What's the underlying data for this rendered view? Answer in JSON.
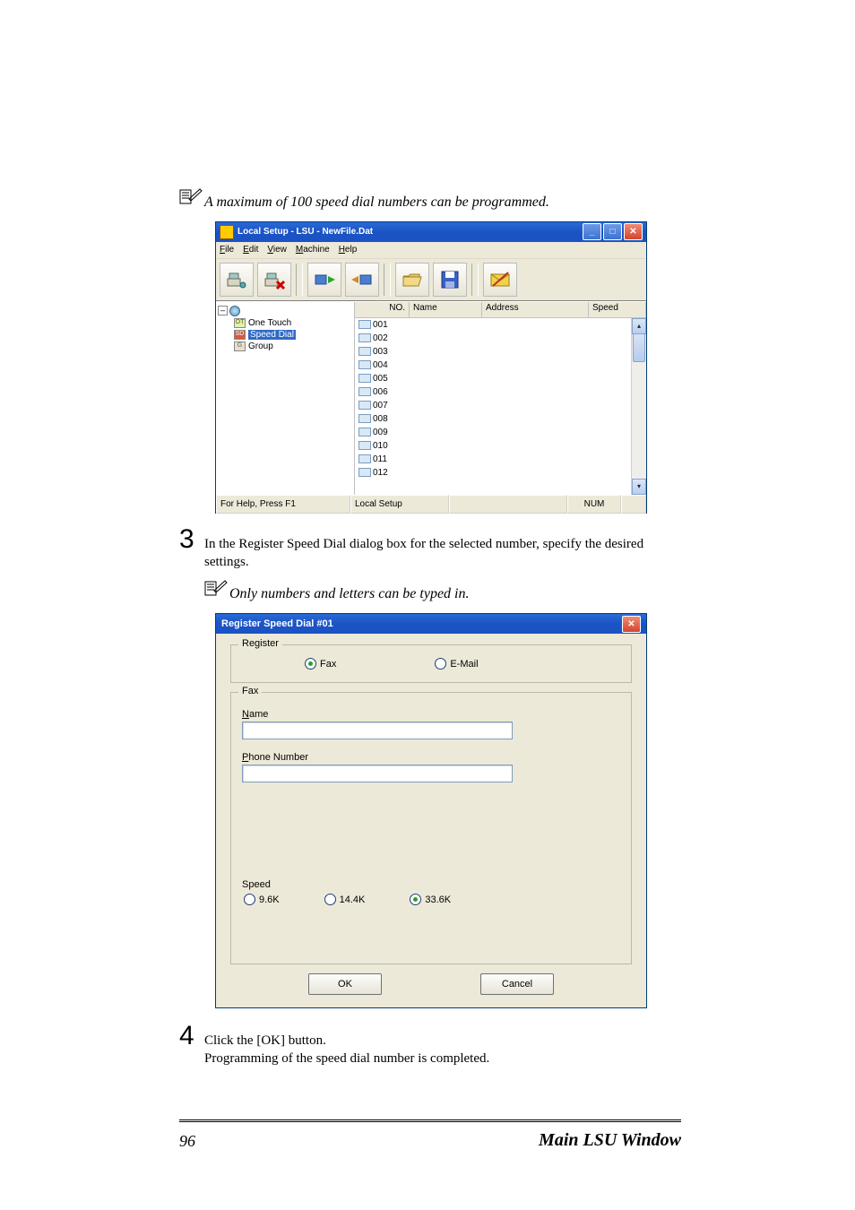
{
  "notes": {
    "note1": "A maximum of 100 speed dial numbers can be programmed.",
    "note2": "Only numbers and letters can be typed in."
  },
  "steps": {
    "s3": {
      "num": "3",
      "text": "In the Register Speed Dial dialog box for the selected number, specify the desired settings."
    },
    "s4": {
      "num": "4",
      "line1": "Click the [OK] button.",
      "line2": "Programming of the speed dial number is completed."
    }
  },
  "win1": {
    "title": "Local Setup - LSU - NewFile.Dat",
    "menus": {
      "file": "File",
      "edit": "Edit",
      "view": "View",
      "machine": "Machine",
      "help": "Help"
    },
    "tree": {
      "root_minus": "–",
      "onetouch": "One Touch",
      "onetouch_badge": "OT",
      "speeddial": "Speed Dial",
      "speeddial_badge": "SD",
      "group": "Group",
      "group_badge": "G"
    },
    "cols": {
      "no": "NO.",
      "name": "Name",
      "addr": "Address",
      "speed": "Speed"
    },
    "rows": [
      "001",
      "002",
      "003",
      "004",
      "005",
      "006",
      "007",
      "008",
      "009",
      "010",
      "011",
      "012"
    ],
    "status": {
      "help": "For Help, Press F1",
      "mode": "Local Setup",
      "num": "NUM"
    }
  },
  "dlg": {
    "title": "Register Speed Dial #01",
    "groups": {
      "register": "Register",
      "fax": "Fax"
    },
    "radios": {
      "fax": "Fax",
      "email": "E-Mail"
    },
    "labels": {
      "name": "Name",
      "phone": "Phone Number",
      "speed": "Speed"
    },
    "speeds": {
      "s96": "9.6K",
      "s144": "14.4K",
      "s336": "33.6K"
    },
    "buttons": {
      "ok": "OK",
      "cancel": "Cancel"
    }
  },
  "footer": {
    "page": "96",
    "title": "Main LSU Window"
  }
}
